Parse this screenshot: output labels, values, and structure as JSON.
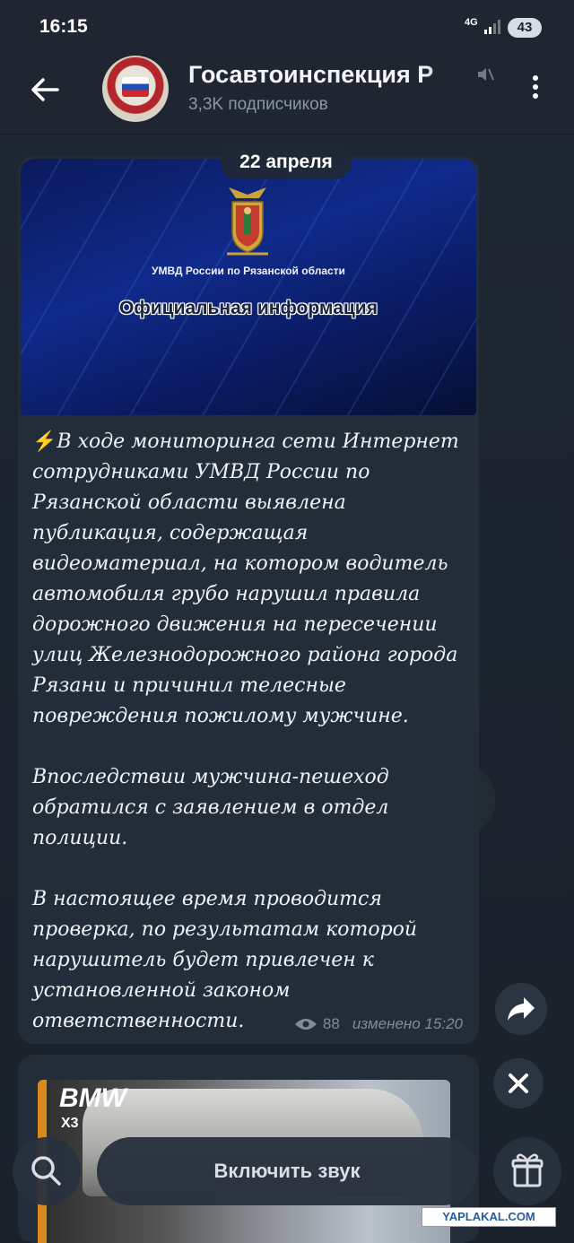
{
  "status_bar": {
    "time": "16:15",
    "network": "4G",
    "battery": "43"
  },
  "header": {
    "title": "Госавтоинспекция Р",
    "subscribers": "3,3K подписчиков",
    "icons": [
      "back-arrow-icon",
      "channel-avatar",
      "mute-icon",
      "more-vertical-icon"
    ]
  },
  "message": {
    "date_chip": "22 апреля",
    "media": {
      "caption": "УМВД России по Рязанской области",
      "title": "Официальная информация"
    },
    "paragraphs": [
      "⚡В ходе мониторинга сети Интернет сотрудниками УМВД России по Рязанской области выявлена публикация, содержащая видеоматериал, на котором водитель автомобиля грубо нарушил правила дорожного движения на пересечении улиц  Железнодорожного района города Рязани и причинил телесные повреждения пожилому мужчине.",
      "Впоследствии мужчина-пешеход обратился с заявлением в отдел полиции.",
      "В настоящее время проводится проверка, по результатам которой нарушитель будет привлечен к установленной законом ответственности."
    ],
    "views": "88",
    "edited": "изменено 15:20"
  },
  "ad": {
    "brand": "BMW",
    "model": "X3"
  },
  "bottom_bar": {
    "sound_label": "Включить звук"
  },
  "watermark": "YAPLAKAL.COM",
  "colors": {
    "background": "#1b2330",
    "bubble": "#232d3a",
    "accent_bolt": "#f5c518"
  }
}
